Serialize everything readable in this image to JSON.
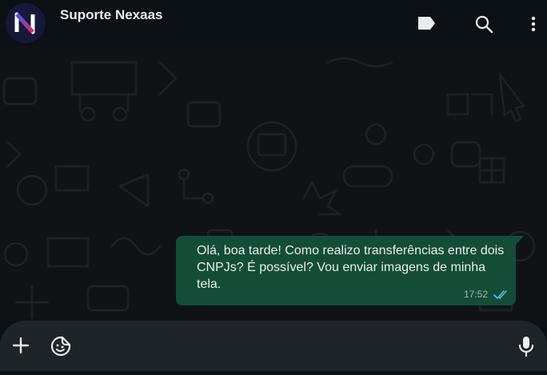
{
  "header": {
    "contact_name": "Suporte Nexaas",
    "avatar_logo_letter": "N"
  },
  "message": {
    "text": "Olá, boa tarde! Como realizo transferências entre dois CNPJs? É possível? Vou enviar imagens de minha tela.",
    "time": "17:52",
    "status": "read"
  },
  "icons": {
    "label": "label-icon",
    "search": "search-icon",
    "menu": "more-vertical-icon",
    "attach": "plus-icon",
    "sticker": "sticker-icon",
    "mic": "mic-icon"
  },
  "colors": {
    "header_bg": "#0b1014",
    "chat_bg": "#0f1316",
    "outgoing_bubble": "#144d37",
    "read_ticks": "#53bdeb",
    "input_bg": "#1f2428"
  }
}
